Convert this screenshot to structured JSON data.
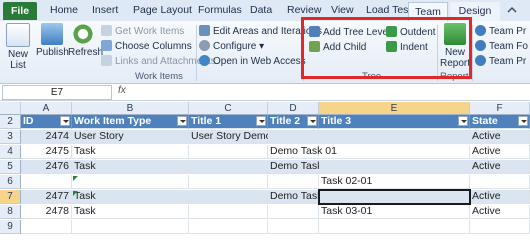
{
  "ribbon_tabs": [
    "File",
    "Home",
    "Insert",
    "Page Layout",
    "Formulas",
    "Data",
    "Review",
    "View",
    "Load Test",
    "Team",
    "Design"
  ],
  "active_tab": "Team",
  "ribbon": {
    "new_list": "New List",
    "publish": "Publish",
    "refresh": "Refresh",
    "get_work_items": "Get Work Items",
    "choose_columns": "Choose Columns",
    "links_attachments": "Links and Attachments",
    "work_items_group": "Work Items",
    "edit_areas": "Edit Areas and Iterations",
    "configure": "Configure",
    "open_web_access": "Open in Web Access",
    "add_tree_level": "Add Tree Level",
    "add_child": "Add Child",
    "outdent": "Outdent",
    "indent": "Indent",
    "tree_group": "Tree",
    "new_report": "New Report",
    "reports_group": "Reports",
    "team_items": [
      "Team Pr",
      "Team Fo",
      "Team Pr"
    ]
  },
  "formula_bar": {
    "name_box": "E7",
    "fx": "fx"
  },
  "grid": {
    "col_letters": [
      "A",
      "B",
      "C",
      "D",
      "E",
      "F"
    ],
    "row_numbers": [
      "2",
      "3",
      "4",
      "5",
      "6",
      "7",
      "8",
      "9"
    ],
    "headers": [
      "ID",
      "Work Item Type",
      "Title 1",
      "Title 2",
      "Title 3",
      "State"
    ],
    "rows": [
      {
        "id": "2474",
        "type": "User Story",
        "t1": "User Story Demo",
        "t2": "",
        "t3": "",
        "state": "Active"
      },
      {
        "id": "2475",
        "type": "Task",
        "t1": "",
        "t2": "Demo Task 01",
        "t3": "",
        "state": "Active"
      },
      {
        "id": "2476",
        "type": "Task",
        "t1": "",
        "t2": "Demo Task 02",
        "t3": "",
        "state": "Active"
      },
      {
        "id": "",
        "type": "",
        "t1": "",
        "t2": "",
        "t3": "Task 02-01",
        "state": ""
      },
      {
        "id": "2477",
        "type": "Task",
        "t1": "",
        "t2": "Demo Task 03",
        "t3": "",
        "state": "Active"
      },
      {
        "id": "2478",
        "type": "Task",
        "t1": "",
        "t2": "",
        "t3": "Task 03-01",
        "state": "Active"
      },
      {
        "id": "",
        "type": "",
        "t1": "",
        "t2": "",
        "t3": "",
        "state": ""
      }
    ]
  },
  "colors": {
    "header_blue": "#4f81bd",
    "band": "#dbe5f1",
    "highlight_red": "#e02828",
    "file_green": "#2a7a3a"
  }
}
